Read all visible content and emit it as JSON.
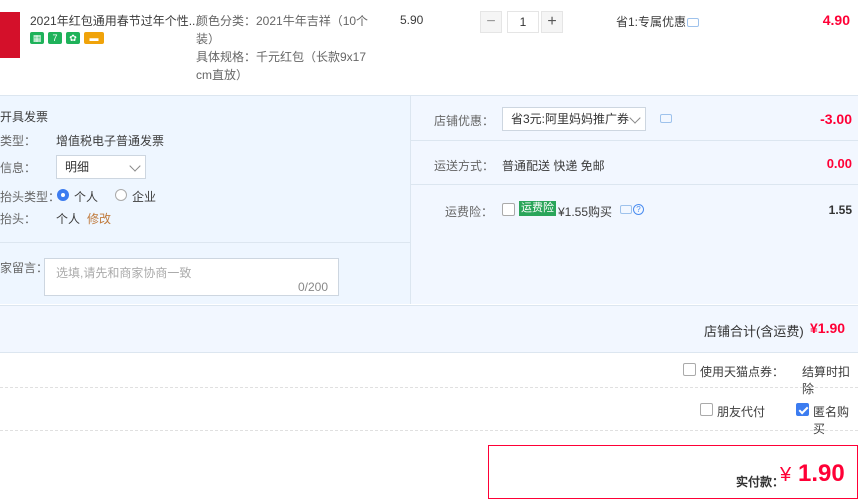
{
  "product": {
    "title": "2021年红包通用春节过年个性...",
    "badges": [
      "#1fb25a",
      "#1fb25a",
      "#1fb25a",
      "#f0a30a"
    ],
    "spec_color_label": "颜色分类：2021牛年吉祥（10个",
    "spec_color_cont": "装）",
    "spec_size_label": "具体规格：千元红包（长款9x17",
    "spec_size_cont": "cm直放）",
    "unit_price": "5.90",
    "quantity": "1",
    "minus": "−",
    "plus": "+",
    "promo": "省1:专属优惠",
    "subtotal": "4.90"
  },
  "invoice": {
    "title": "开具发票",
    "type_label": "类型：",
    "type_value": "增值税电子普通发票",
    "info_label": "信息：",
    "info_value": "明细",
    "header_type_label": "抬头类型：",
    "header_type_options": [
      "个人",
      "企业"
    ],
    "header_label": "抬头：",
    "header_value": "个人",
    "modify": "修改"
  },
  "message": {
    "label": "家留言：",
    "placeholder": "选填,请先和商家协商一致",
    "counter": "0/200"
  },
  "store_discount": {
    "label": "店铺优惠：",
    "value": "省3元:阿里妈妈推广券",
    "amount": "-3.00"
  },
  "shipping": {
    "label": "运送方式：",
    "value": "普通配送 快递 免邮",
    "amount": "0.00"
  },
  "insurance": {
    "label": "运费险：",
    "tag": "运费险",
    "price": "¥1.55购买",
    "amount": "1.55"
  },
  "store_total": {
    "label": "店铺合计(含运费)",
    "amount": "¥1.90"
  },
  "tmall_points": {
    "label": "使用天猫点券：",
    "note": "结算时扣除"
  },
  "options": {
    "friend_pay": "朋友代付",
    "anonymous": "匿名购买"
  },
  "payment": {
    "label": "实付款：",
    "currency": "¥",
    "amount": "1.90"
  },
  "colors": {
    "accent_red": "#ff0036",
    "accent_blue": "#3c7cf0",
    "panel_bg": "#eef6ff"
  }
}
